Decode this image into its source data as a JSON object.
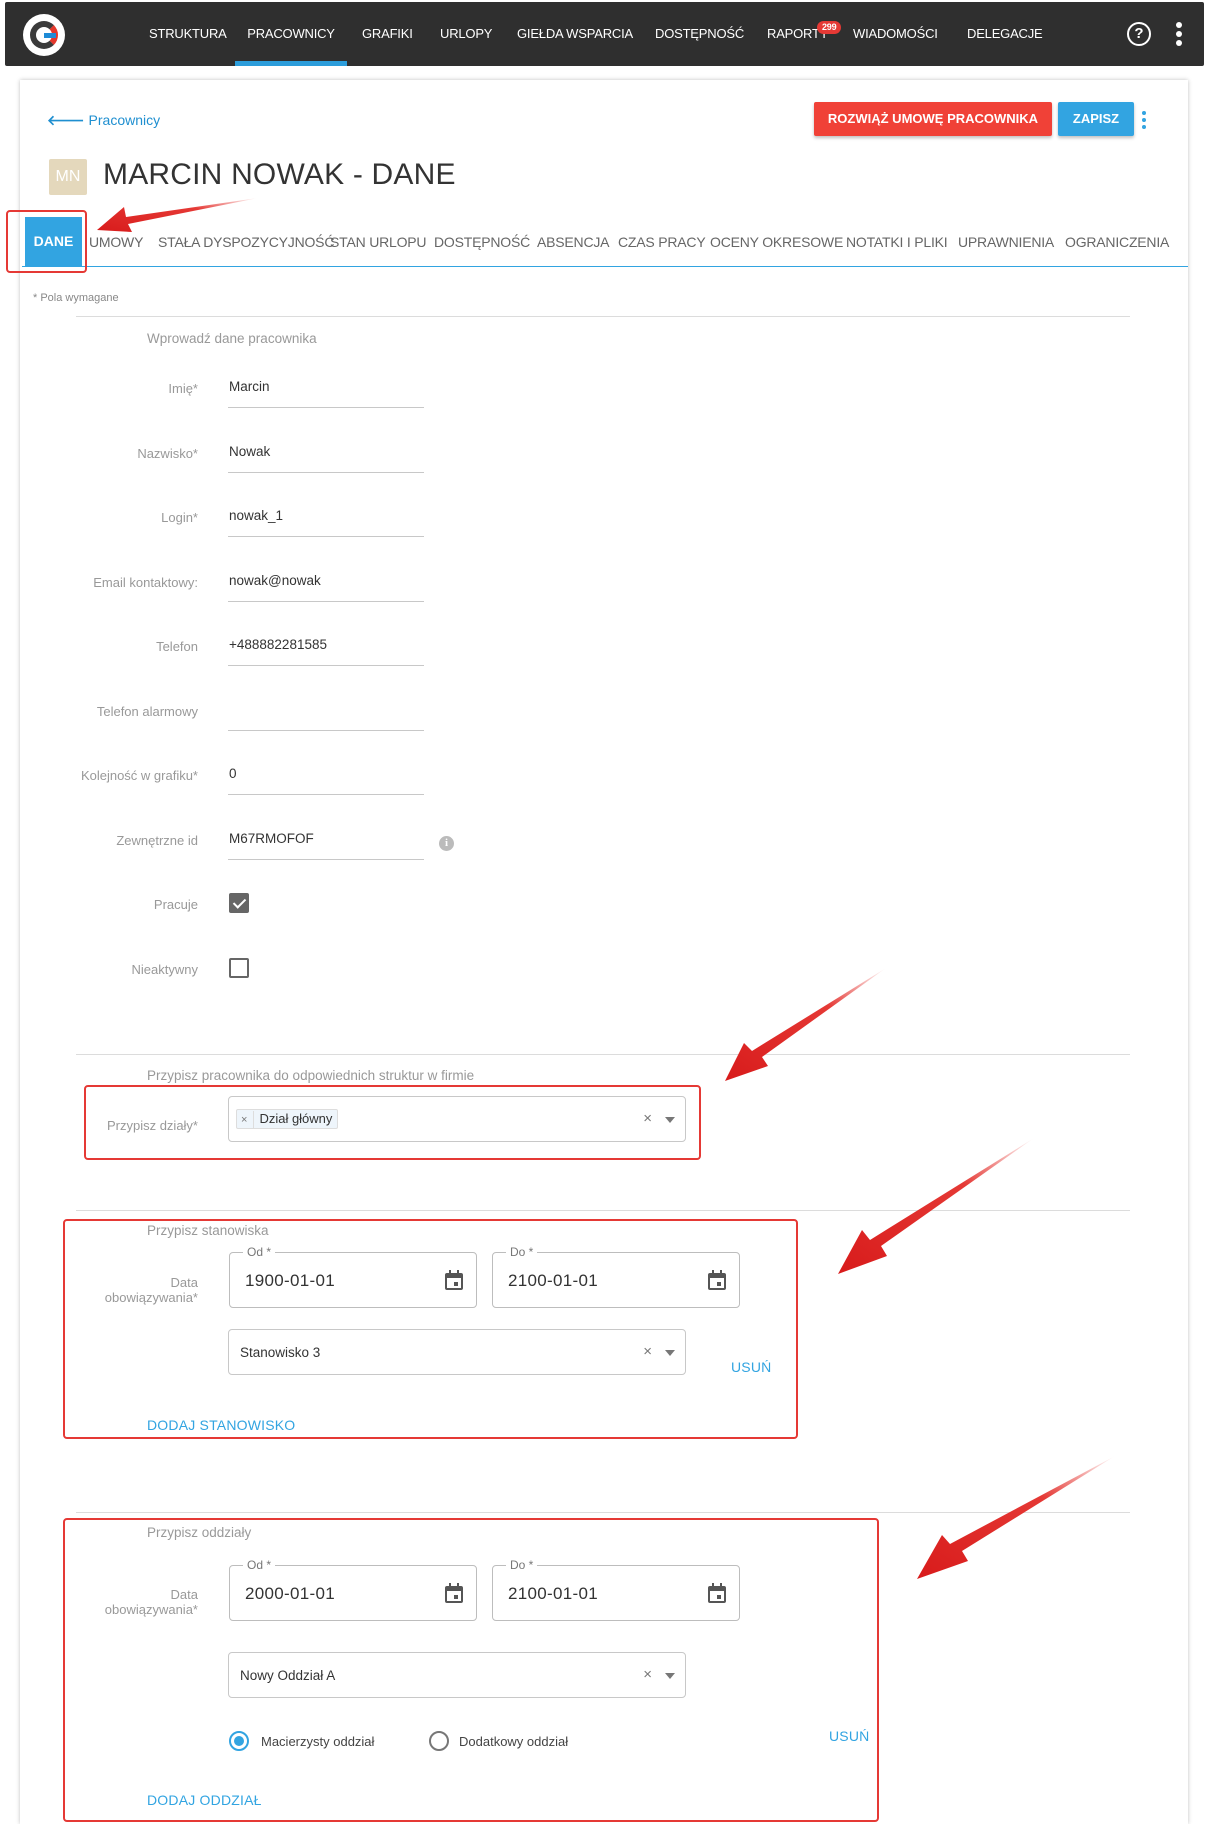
{
  "nav": {
    "items": [
      "STRUKTURA",
      "PRACOWNICY",
      "GRAFIKI",
      "URLOPY",
      "GIEŁDA WSPARCIA",
      "DOSTĘPNOŚĆ",
      "RAPORTY",
      "WIADOMOŚCI",
      "DELEGACJE"
    ],
    "active": "PRACOWNICY",
    "raporty_badge": "299",
    "help_icon": "question-circle-icon",
    "menu_icon": "kebab-menu-icon"
  },
  "header": {
    "back_link": "Pracownicy",
    "back_icon": "arrow-left-icon",
    "terminate_button": "ROZWIĄŻ UMOWĘ PRACOWNIKA",
    "save_button": "ZAPISZ",
    "avatar_initials": "MN",
    "title": "MARCIN NOWAK - DANE"
  },
  "tabs": [
    "DANE",
    "UMOWY",
    "STAŁA DYSPOZYCYJNOŚĆ",
    "STAN URLOPU",
    "DOSTĘPNOŚĆ",
    "ABSENCJA",
    "CZAS PRACY",
    "OCENY OKRESOWE",
    "NOTATKI I PLIKI",
    "UPRAWNIENIA",
    "OGRANICZENIA"
  ],
  "required_note": "* Pola wymagane",
  "employee_section": {
    "title": "Wprowadź dane pracownika",
    "fields": [
      {
        "label": "Imię*",
        "value": "Marcin"
      },
      {
        "label": "Nazwisko*",
        "value": "Nowak"
      },
      {
        "label": "Login*",
        "value": "nowak_1"
      },
      {
        "label": "Email kontaktowy:",
        "value": "nowak@nowak"
      },
      {
        "label": "Telefon",
        "value": "+488882281585"
      },
      {
        "label": "Telefon alarmowy",
        "value": ""
      },
      {
        "label": "Kolejność w grafiku*",
        "value": "0"
      },
      {
        "label": "Zewnętrzne id",
        "value": "M67RMOFOF"
      }
    ],
    "pracuje_label": "Pracuje",
    "pracuje_checked": true,
    "nieaktywny_label": "Nieaktywny",
    "nieaktywny_checked": false
  },
  "departments_section": {
    "title": "Przypisz pracownika do odpowiednich struktur w firmie",
    "label": "Przypisz działy*",
    "chip": "Dział główny"
  },
  "positions_section": {
    "title": "Przypisz stanowiska",
    "date_label": "Data obowiązywania*",
    "from_label": "Od *",
    "from_value": "1900-01-01",
    "to_label": "Do *",
    "to_value": "2100-01-01",
    "position": "Stanowisko 3",
    "remove_link": "USUŃ",
    "add_link": "DODAJ STANOWISKO"
  },
  "branches_section": {
    "title": "Przypisz oddziały",
    "date_label": "Data obowiązywania*",
    "from_label": "Od *",
    "from_value": "2000-01-01",
    "to_label": "Do *",
    "to_value": "2100-01-01",
    "branch": "Nowy Oddział A",
    "radio_primary": "Macierzysty oddział",
    "radio_secondary": "Dodatkowy oddział",
    "primary_selected": true,
    "remove_link": "USUŃ",
    "add_link": "DODAJ ODDZIAŁ"
  },
  "colors": {
    "accent": "#32a4e1",
    "danger": "#f04137",
    "nav_bg": "#2f2f2f",
    "annotation": "#e53935"
  }
}
